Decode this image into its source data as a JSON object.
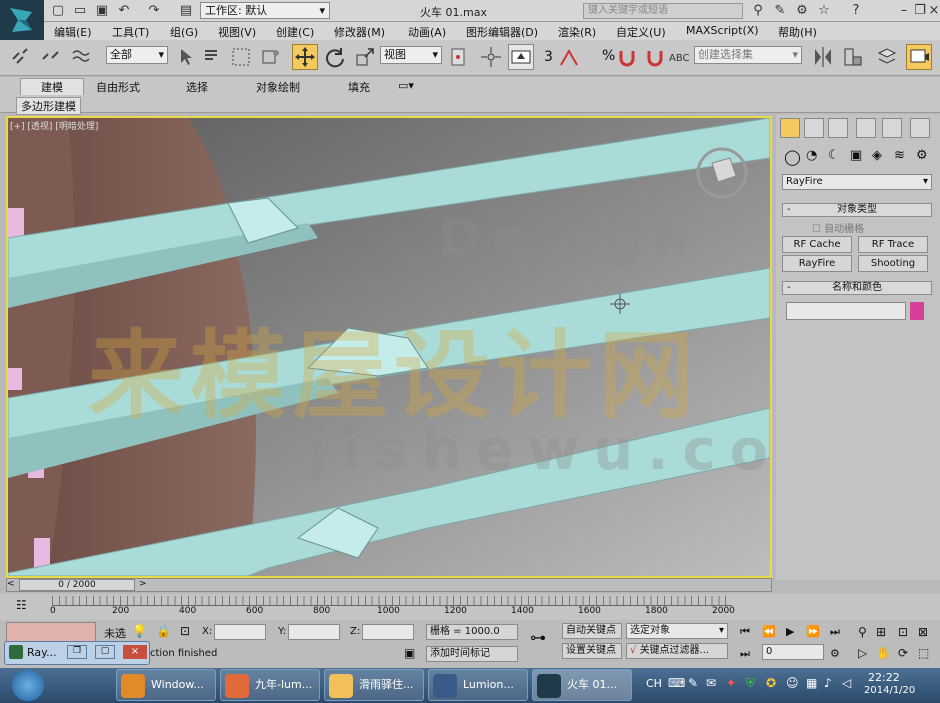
{
  "titlebar": {
    "workspace_label": "工作区: 默认",
    "file_title": "火车 01.max",
    "search_placeholder": "键入关键字或短语"
  },
  "menu": [
    "编辑(E)",
    "工具(T)",
    "组(G)",
    "视图(V)",
    "创建(C)",
    "修改器(M)",
    "动画(A)",
    "图形编辑器(D)",
    "渲染(R)",
    "自定义(U)",
    "MAXScript(X)",
    "帮助(H)"
  ],
  "toolbar": {
    "selection_filter": "全部",
    "ref_coord": "视图",
    "named_selection": "创建选择集",
    "angle_snap": "3",
    "percent_snap": "%"
  },
  "ribbon": {
    "tabs": [
      "建模",
      "自由形式",
      "选择",
      "对象绘制",
      "填充"
    ],
    "subtab": "多边形建模"
  },
  "viewport": {
    "label": "[+] [透视] [明暗处理]",
    "watermark_cn": "来模屋设计网",
    "watermark_en_top": "Design",
    "watermark_en_bottom": "jishewu.com"
  },
  "cmdpanel": {
    "category_dropdown": "RayFire",
    "rollout_object_type": "对象类型",
    "autogrid_label": "自动栅格",
    "buttons": [
      "RF Cache",
      "RF Trace",
      "RayFire",
      "Shooting"
    ],
    "rollout_name_color": "名称和颜色",
    "object_color": "#d6409a"
  },
  "timeline": {
    "frame_display": "0 / 2000",
    "ticks": [
      "0",
      "200",
      "400",
      "600",
      "800",
      "1000",
      "1200",
      "1400",
      "1600",
      "1800",
      "2000"
    ]
  },
  "status": {
    "selection_text": "未选",
    "x_label": "X:",
    "y_label": "Y:",
    "z_label": "Z:",
    "grid_text": "栅格 = 1000.0",
    "auto_key": "自动关键点",
    "set_key": "设置关键点",
    "key_mode": "选定对象",
    "key_filters": "关键点过滤器...",
    "add_time_tag": "添加时间标记",
    "prompt_text": "ction finished",
    "frame_field": "0"
  },
  "floating_window": {
    "title": "Ray..."
  },
  "taskbar": {
    "items": [
      "Window...",
      "九年-lum...",
      "滑雨驿住...",
      "Lumion...",
      "火车 01..."
    ],
    "clock_time": "22:22",
    "clock_date": "2014/1/20",
    "tray_lang": "CH"
  }
}
